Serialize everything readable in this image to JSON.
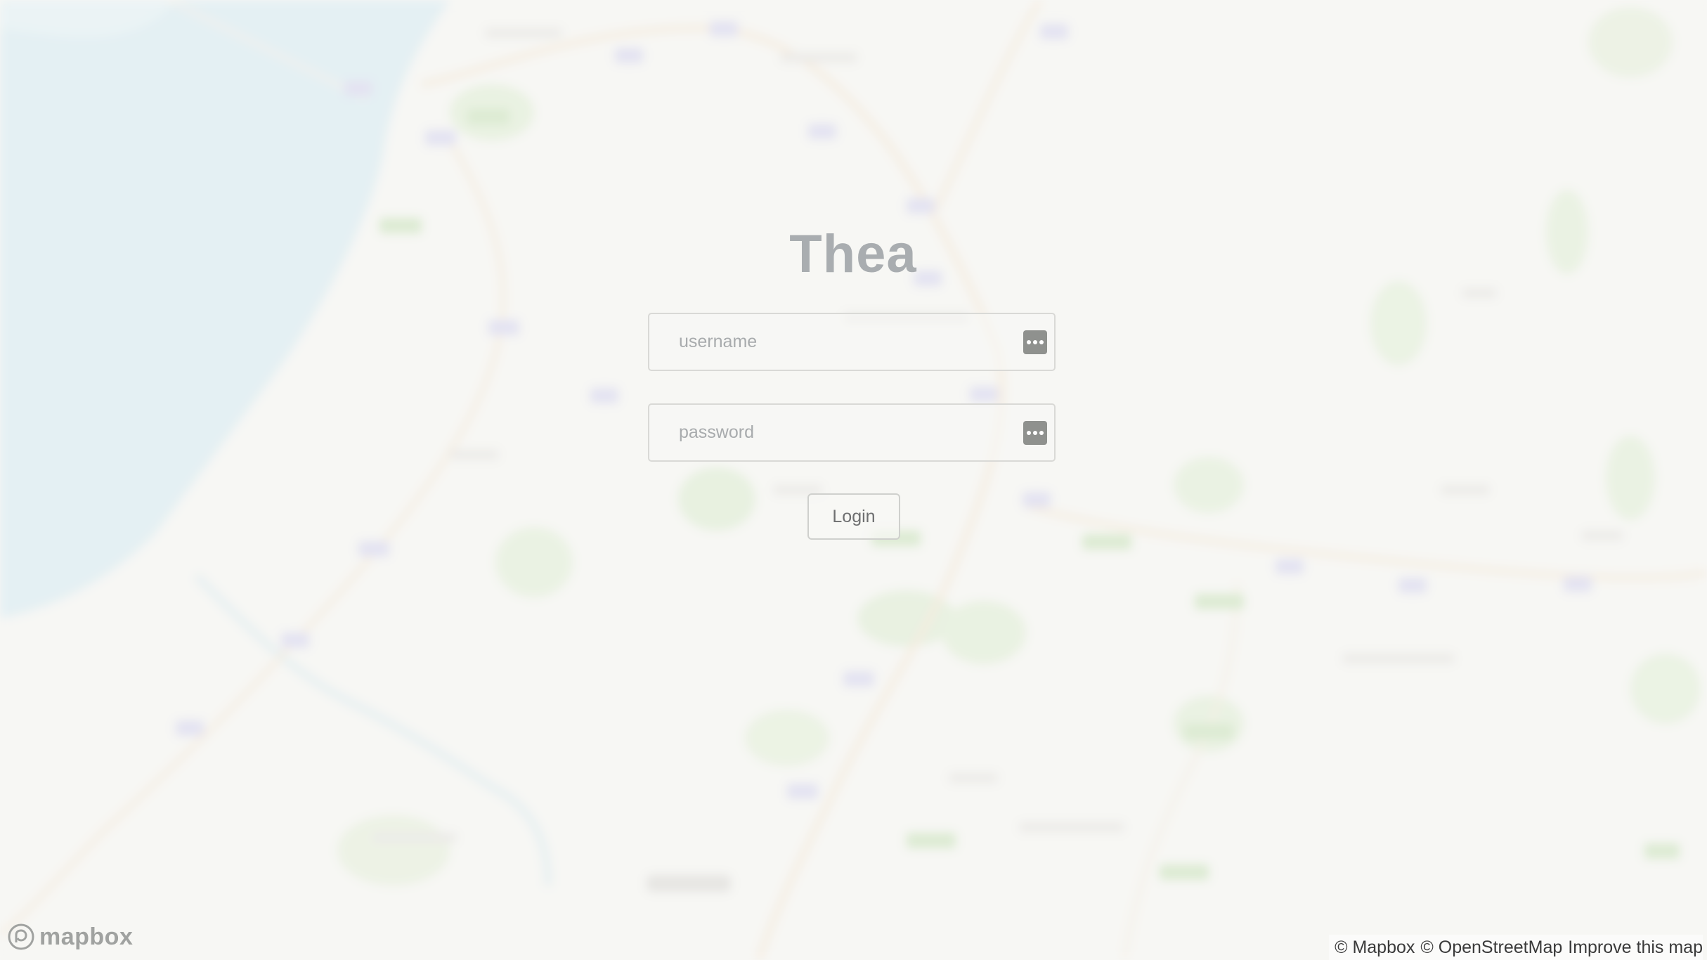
{
  "app": {
    "title": "Thea"
  },
  "login_form": {
    "username": {
      "placeholder": "username",
      "value": "",
      "icon": "password-manager-icon"
    },
    "password": {
      "placeholder": "password",
      "value": "",
      "icon": "password-manager-icon"
    },
    "submit_label": "Login"
  },
  "map": {
    "logo_text": "mapbox",
    "attribution": {
      "mapbox": "© Mapbox",
      "osm": "© OpenStreetMap",
      "improve": "Improve this map"
    }
  },
  "colors": {
    "title": "#a9adb0",
    "water": "#cfe6ee",
    "land": "#f4f4f1",
    "park": "#d4e6c4"
  }
}
